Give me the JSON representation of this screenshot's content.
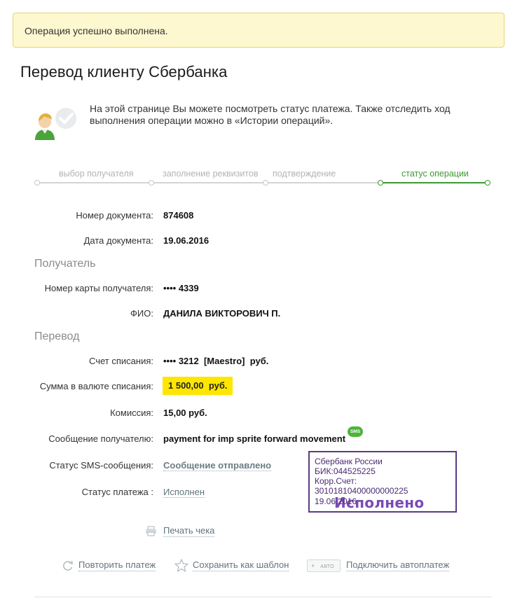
{
  "alert": {
    "text": "Операция успешно выполнена."
  },
  "page": {
    "title": "Перевод клиенту Сбербанка"
  },
  "info": {
    "text": "На этой странице Вы можете посмотреть статус платежа. Также отследить ход выполнения операции можно в «Истории операций»."
  },
  "steps": [
    {
      "label": "выбор получателя",
      "state": "done"
    },
    {
      "label": "заполнение реквизитов",
      "state": "done"
    },
    {
      "label": "подтверждение",
      "state": "done"
    },
    {
      "label": "статус операции",
      "state": "active"
    }
  ],
  "document": {
    "number_label": "Номер документа:",
    "number": "874608",
    "date_label": "Дата документа:",
    "date": "19.06.2016"
  },
  "recipient": {
    "section_title": "Получатель",
    "card_label": "Номер карты получателя:",
    "card": "•••• 4339",
    "name_label": "ФИО:",
    "name": "ДАНИЛА ВИКТОРОВИЧ П."
  },
  "transfer": {
    "section_title": "Перевод",
    "account_label": "Счет списания:",
    "account": "•••• 3212  [Maestro]  руб.",
    "amount_label": "Сумма в валюте списания:",
    "amount": "1 500,00  руб.",
    "fee_label": "Комиссия:",
    "fee": "15,00 руб.",
    "message_label": "Сообщение получателю:",
    "message": "payment for imp sprite forward movement",
    "sms_badge": "SMS",
    "sms_status_label": "Статус SMS-сообщения:",
    "sms_status": "Сообщение отправлено",
    "payment_status_label": "Статус платежа :",
    "payment_status": "Исполнен"
  },
  "stamp": {
    "bank": "Сбербанк России",
    "bik": "БИК:044525225",
    "corr": "Корр.Счет: 30101810400000000225",
    "status": "Исполнено",
    "date": "19.06.2016"
  },
  "actions": {
    "print": "Печать чека",
    "repeat": "Повторить платеж",
    "save_template": "Сохранить как шаблон",
    "auto_badge": "авто",
    "autopay": "Подключить автоплатеж"
  },
  "colors": {
    "accent_green": "#3c9a32",
    "alert_bg": "#fdf8d0",
    "highlight": "#ffe600",
    "stamp": "#5b3b82"
  }
}
